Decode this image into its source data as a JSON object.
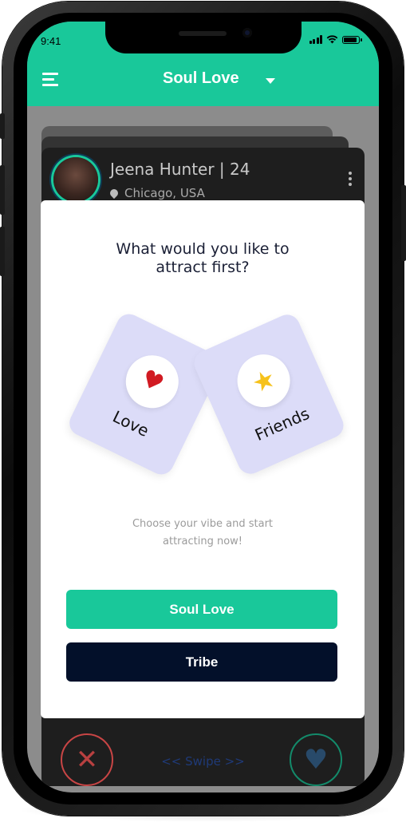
{
  "status_bar": {
    "time": "9:41"
  },
  "header": {
    "title": "Soul Love"
  },
  "profile": {
    "name": "Jeena Hunter | 24",
    "location": "Chicago, USA"
  },
  "modal": {
    "question_line1": "What would you like to",
    "question_line2": "attract first?",
    "options": [
      {
        "label": "Love",
        "icon": "heart-icon"
      },
      {
        "label": "Friends",
        "icon": "star-icon"
      }
    ],
    "subtitle_line1": "Choose your vibe and start",
    "subtitle_line2": "attracting now!",
    "primary_button": "Soul Love",
    "secondary_button": "Tribe"
  },
  "bottom_bar": {
    "swipe_label": "<< Swipe >>"
  },
  "colors": {
    "accent": "#19c89a",
    "dark": "#03102a",
    "tile": "#dcdcf8",
    "heart": "#d11a22",
    "star": "#f6c21c"
  }
}
